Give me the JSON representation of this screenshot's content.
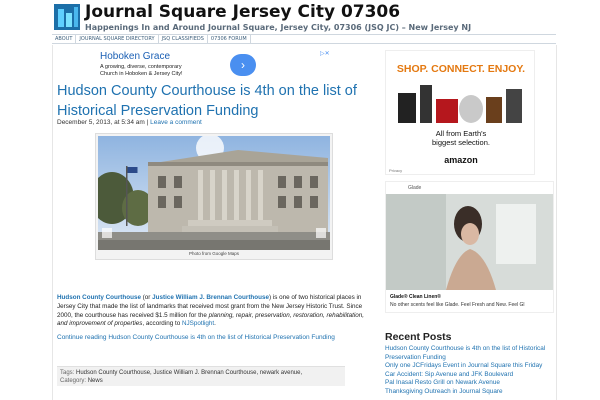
{
  "site": {
    "title": "Journal Square Jersey City 07306",
    "description": "Happenings In and Around Journal Square, Jersey City, 07306 (JSQ JC) – New Jersey NJ"
  },
  "nav": {
    "items": [
      "ABOUT",
      "JOURNAL SQUARE DIRECTORY",
      "JSQ CLASSIFIEDS",
      "07306 FORUM"
    ]
  },
  "ad_top": {
    "title": "Hoboken Grace",
    "line1": "A growing, diverse, contemporary",
    "line2": "Church in Hoboken & Jersey City!",
    "button_icon": "chevron-right-icon"
  },
  "post": {
    "title": "Hudson County Courthouse is 4th on the list of Historical Preservation Funding",
    "date": "December 5, 2013, at 5:34 am",
    "separator": "|",
    "comment_link": "Leave a comment",
    "photo_caption": "Photo from Google Maps",
    "para": {
      "link1": "Hudson County Courthouse",
      "t1": " (or ",
      "link2": "Justice William J. Brennan Courthouse",
      "t2": ") is one of two historical places in Jersey City that made the list of landmarks that received most grant from the New Jersey Historic Trust. Since 2000, the courthouse has received $1.5 million for the ",
      "italic": "planning, repair, preservation, restoration, rehabilitation, and improvement of properties",
      "t3": ", according to ",
      "link3": "NJSpotlight",
      "t4": "."
    },
    "continue_link": "Continue reading Hudson County Courthouse is 4th on the list of Historical Preservation Funding",
    "tags_label": "Tags:",
    "tags_value": "Hudson County Courthouse, Justice William J. Brennan Courthouse, newark avenue,",
    "category_label": "Category:",
    "category_value": "News"
  },
  "sidebar": {
    "amazon_ad": {
      "headline": "SHOP. CONNECT. ENJOY.",
      "subline1": "All from Earth's",
      "subline2": "biggest selection.",
      "logo": "amazon",
      "privacy": "Privacy"
    },
    "glade_ad": {
      "brand": "Glade",
      "product": "Glade® Clean Linen®",
      "tagline": "No other scents feel like Glade. Feel Fresh and New. Feel Gl"
    },
    "recent_heading": "Recent Posts",
    "recent_posts": [
      "Hudson County Courthouse is 4th on the list of Historical",
      "Preservation Funding",
      "Only one JCFridays Event in Journal Square this Friday",
      "Car Accident: Sip Avenue and JFK Boulevard",
      "Pal Inasal Resto Grill on Newark Avenue",
      "Thanksgiving Outreach in Journal Square"
    ]
  },
  "colors": {
    "link": "#1f72b0",
    "amazon_orange": "#e47911",
    "ad_button": "#4a8ff0"
  }
}
